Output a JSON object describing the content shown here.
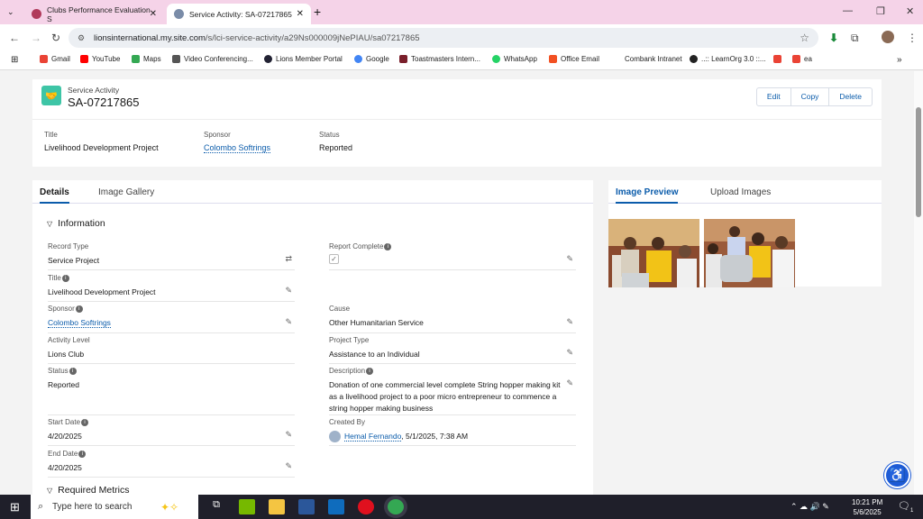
{
  "browser": {
    "tabs": [
      {
        "title": "Clubs Performance Evaluation S",
        "active": false
      },
      {
        "title": "Service Activity: SA-07217865",
        "active": true
      }
    ],
    "url_host": "lionsinternational.my.site.com",
    "url_path": "/s/lci-service-activity/a29Ns000009jNePIAU/sa07217865",
    "bookmarks": [
      "Gmail",
      "YouTube",
      "Maps",
      "Video Conferencing...",
      "Lions Member Portal",
      "Google",
      "Toastmasters Intern...",
      "WhatsApp",
      "Office Email",
      "Combank Intranet",
      "..:: LearnOrg 3.0 ::...",
      "",
      "ea"
    ]
  },
  "record": {
    "type_label": "Service Activity",
    "name": "SA-07217865",
    "buttons": {
      "edit": "Edit",
      "copy": "Copy",
      "delete": "Delete"
    },
    "highlights": {
      "title_label": "Title",
      "title": "Livelihood Development Project",
      "sponsor_label": "Sponsor",
      "sponsor": "Colombo Softrings",
      "status_label": "Status",
      "status": "Reported"
    }
  },
  "left_tabs": [
    "Details",
    "Image Gallery"
  ],
  "right_tabs": [
    "Image Preview",
    "Upload Images"
  ],
  "sections": {
    "information": "Information",
    "metrics": "Required Metrics"
  },
  "fields": {
    "record_type": {
      "label": "Record Type",
      "value": "Service Project"
    },
    "report_complete": {
      "label": "Report Complete",
      "value": "✓"
    },
    "title": {
      "label": "Title",
      "value": "Livelihood Development Project"
    },
    "sponsor": {
      "label": "Sponsor",
      "value": "Colombo Softrings"
    },
    "cause": {
      "label": "Cause",
      "value": "Other Humanitarian Service"
    },
    "activity_level": {
      "label": "Activity Level",
      "value": "Lions Club"
    },
    "project_type": {
      "label": "Project Type",
      "value": "Assistance to an Individual"
    },
    "status": {
      "label": "Status",
      "value": "Reported"
    },
    "description": {
      "label": "Description",
      "value": "Donation of one commercial level complete String hopper making kit as a livelihood project to a poor micro entrepreneur to commence a string hopper making business"
    },
    "start_date": {
      "label": "Start Date",
      "value": "4/20/2025"
    },
    "created_by": {
      "label": "Created By",
      "user": "Hemal Fernando",
      "date": ", 5/1/2025, 7:38 AM"
    },
    "end_date": {
      "label": "End Date",
      "value": "4/20/2025"
    }
  },
  "taskbar": {
    "search_placeholder": "Type here to search",
    "time": "10:21 PM",
    "date": "5/6/2025",
    "notif": "1"
  }
}
